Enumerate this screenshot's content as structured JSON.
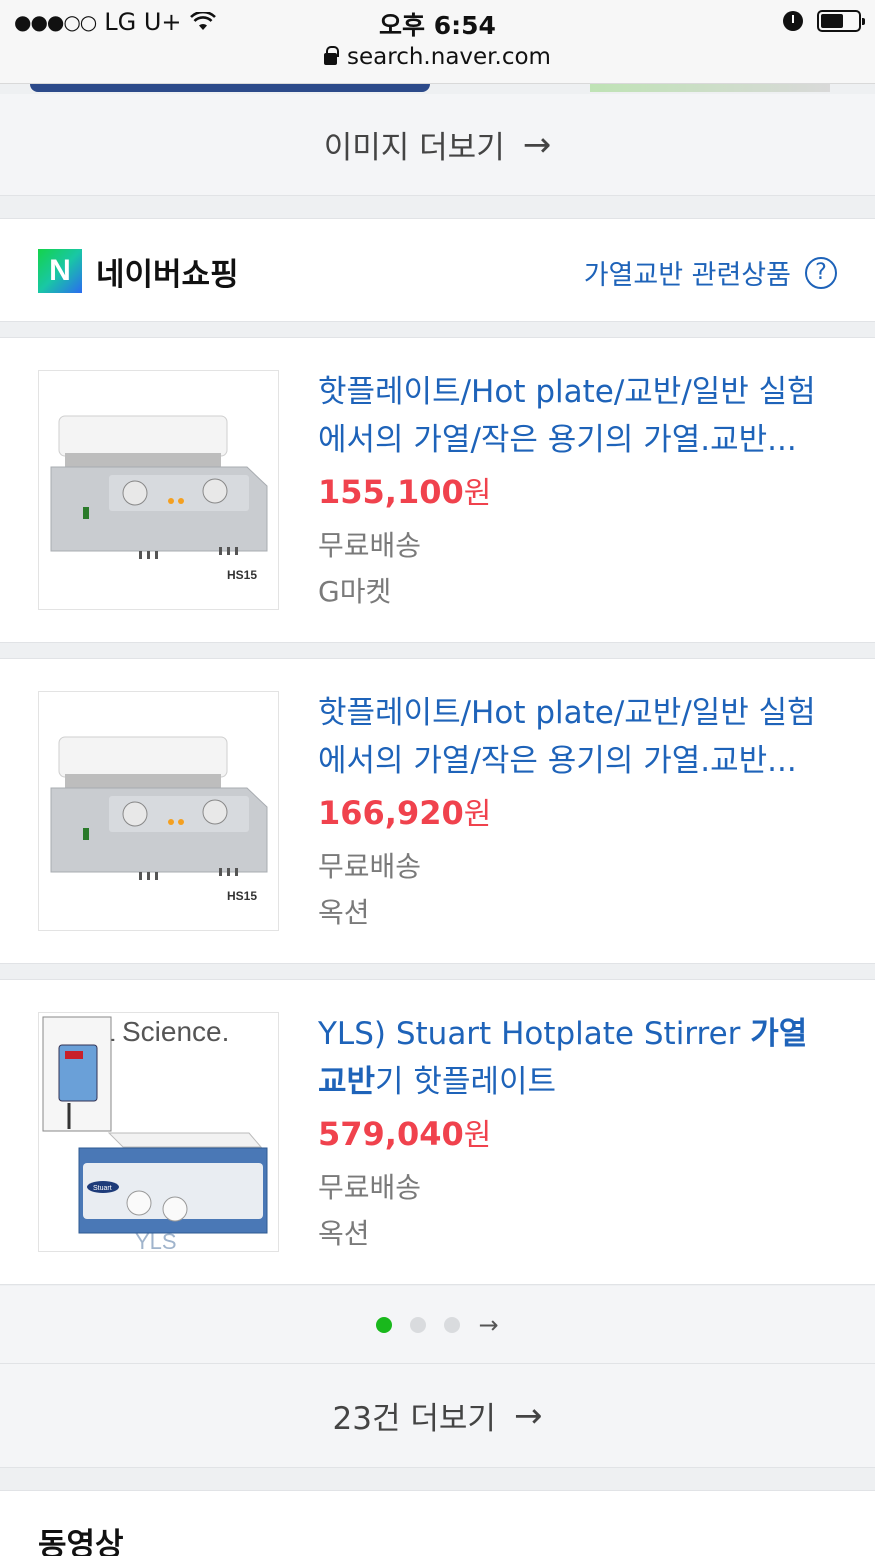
{
  "status_bar": {
    "carrier": "LG U+",
    "time": "오후 6:54",
    "url": "search.naver.com"
  },
  "image_section": {
    "more_label": "이미지 더보기"
  },
  "shopping": {
    "title": "네이버쇼핑",
    "logo_letter": "N",
    "related_label": "가열교반 관련상품",
    "products": [
      {
        "title": "핫플레이트/Hot plate/교반/일반 실험에서의 가열/작은 용기의 가열.교반...",
        "price": "155,100",
        "currency": "원",
        "shipping": "무료배송",
        "store": "G마켓",
        "image_label": "HS15"
      },
      {
        "title": "핫플레이트/Hot plate/교반/일반 실험에서의 가열/작은 용기의 가열.교반...",
        "price": "166,920",
        "currency": "원",
        "shipping": "무료배송",
        "store": "옥션",
        "image_label": "HS15"
      },
      {
        "title_pre": "YLS) Stuart Hotplate Stirrer ",
        "title_bold1": "가열",
        "title_bold2": "교반",
        "title_post": "기 핫플레이트",
        "price": "579,040",
        "currency": "원",
        "shipping": "무료배송",
        "store": "옥션",
        "image_label": "YL Science.",
        "image_watermark": "YLS",
        "image_brand": "Stuart"
      }
    ],
    "pager": {
      "pages": 3,
      "current": 1
    },
    "more_count_label": "23건 더보기"
  },
  "video_section": {
    "title": "동영상"
  },
  "colors": {
    "link_blue": "#1e63b9",
    "price_red": "#f0424d",
    "pager_active": "#19b81c"
  },
  "icons": [
    "lock-icon",
    "wifi-icon",
    "alarm-icon",
    "battery-icon",
    "arrow-right-icon",
    "question-circle-icon"
  ]
}
